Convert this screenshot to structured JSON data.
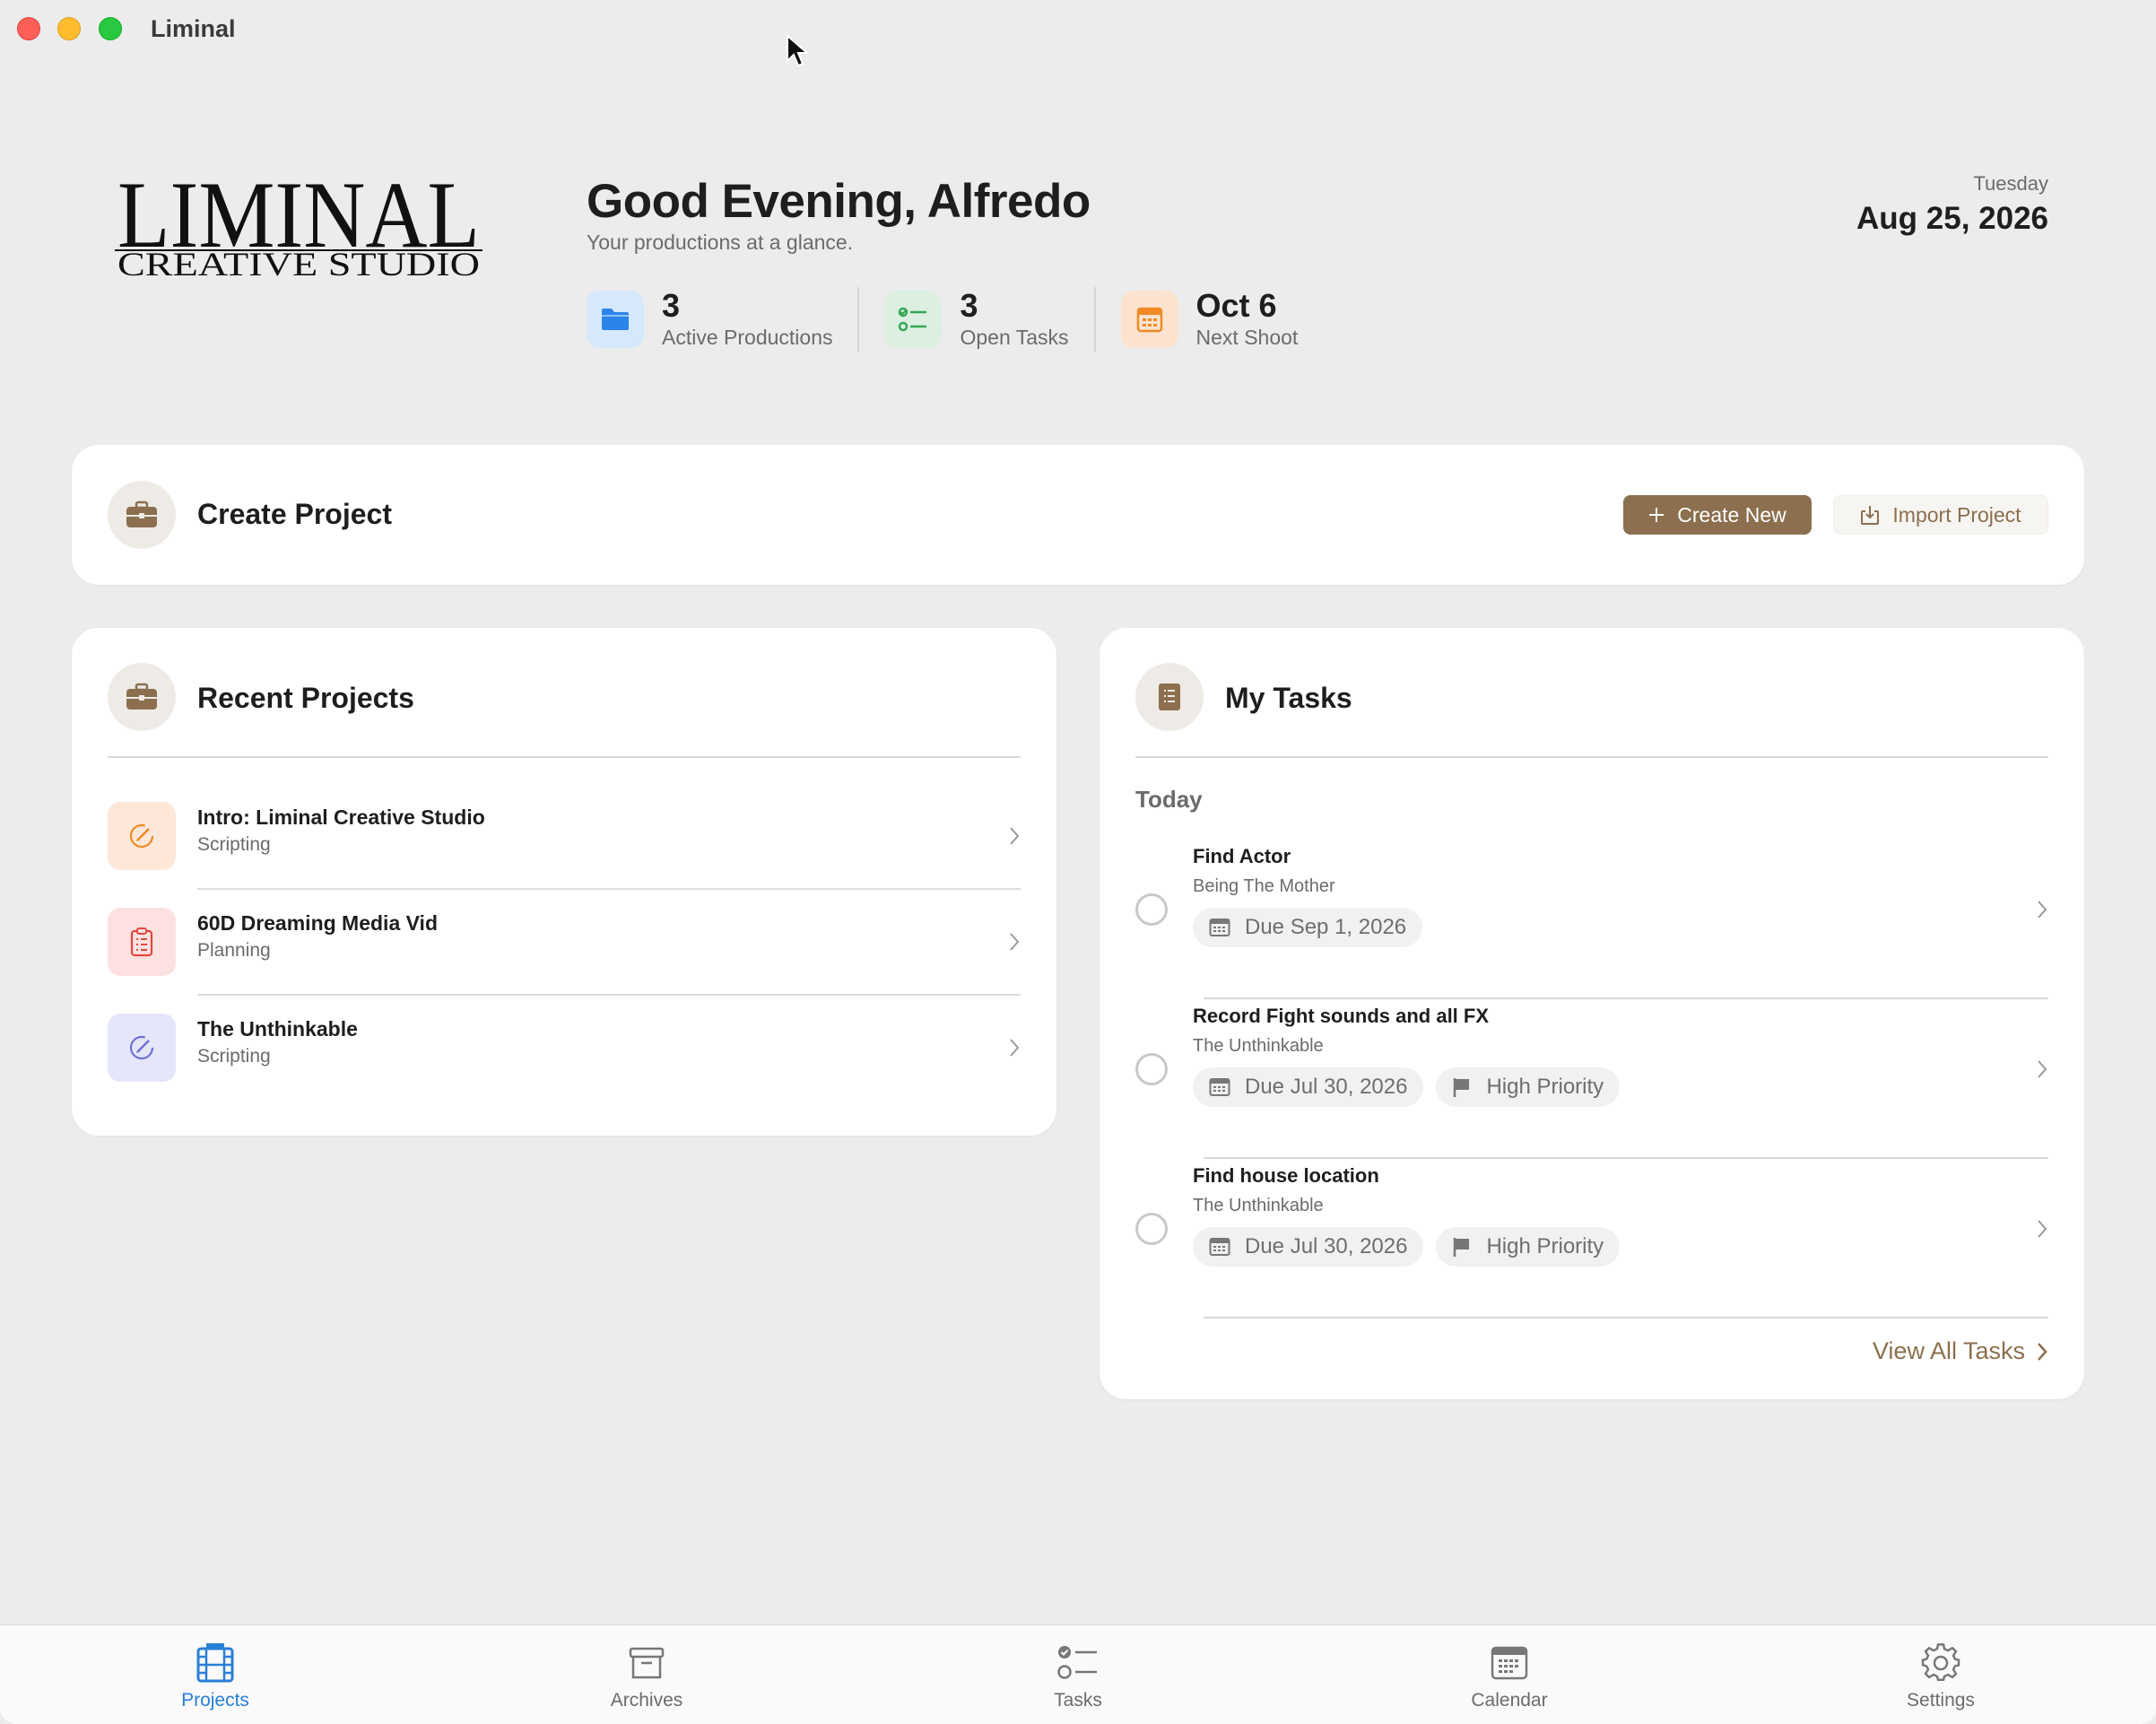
{
  "window": {
    "title": "Liminal"
  },
  "logo": {
    "line1": "LIMINAL",
    "line2": "CREATIVE STUDIO"
  },
  "header": {
    "greeting": "Good Evening, Alfredo",
    "subtitle": "Your productions at a glance.",
    "day": "Tuesday",
    "date": "Aug 25, 2026"
  },
  "stats": [
    {
      "value": "3",
      "label": "Active Productions",
      "icon": "folder-icon",
      "color": "#2a84ea",
      "bg": "#d6e8fb"
    },
    {
      "value": "3",
      "label": "Open Tasks",
      "icon": "checklist-icon",
      "color": "#34a853",
      "bg": "#dcefe0"
    },
    {
      "value": "Oct 6",
      "label": "Next Shoot",
      "icon": "calendar-icon",
      "color": "#f08a24",
      "bg": "#fbe3cf"
    }
  ],
  "create_project": {
    "title": "Create Project",
    "create_label": "Create New",
    "import_label": "Import Project"
  },
  "recent_projects": {
    "title": "Recent Projects",
    "items": [
      {
        "name": "Intro: Liminal Creative Studio",
        "status": "Scripting",
        "icon": "pencil-circle-icon",
        "color": "#f08a24",
        "bg": "#fde7d9"
      },
      {
        "name": "60D Dreaming Media Vid",
        "status": "Planning",
        "icon": "clipboard-icon",
        "color": "#e0493f",
        "bg": "#fde1e1"
      },
      {
        "name": "The Unthinkable",
        "status": "Scripting",
        "icon": "pencil-circle-icon",
        "color": "#6f6fd6",
        "bg": "#e6e6fb"
      }
    ]
  },
  "tasks": {
    "title": "My Tasks",
    "section": "Today",
    "items": [
      {
        "name": "Find Actor",
        "project": "Being The Mother",
        "due": "Due Sep 1, 2026",
        "priority": ""
      },
      {
        "name": "Record Fight sounds and all FX",
        "project": "The Unthinkable",
        "due": "Due Jul 30, 2026",
        "priority": "High Priority"
      },
      {
        "name": "Find house location",
        "project": "The Unthinkable",
        "due": "Due Jul 30, 2026",
        "priority": "High Priority"
      }
    ],
    "view_all": "View All Tasks"
  },
  "tabs": [
    {
      "label": "Projects",
      "icon": "film-icon",
      "active": true
    },
    {
      "label": "Archives",
      "icon": "archive-box-icon",
      "active": false
    },
    {
      "label": "Tasks",
      "icon": "checklist-icon",
      "active": false
    },
    {
      "label": "Calendar",
      "icon": "calendar-icon",
      "active": false
    },
    {
      "label": "Settings",
      "icon": "gear-icon",
      "active": false
    }
  ],
  "colors": {
    "accent": "#8b6f4e",
    "tab_active": "#2a7fd6",
    "background": "#ececec"
  }
}
